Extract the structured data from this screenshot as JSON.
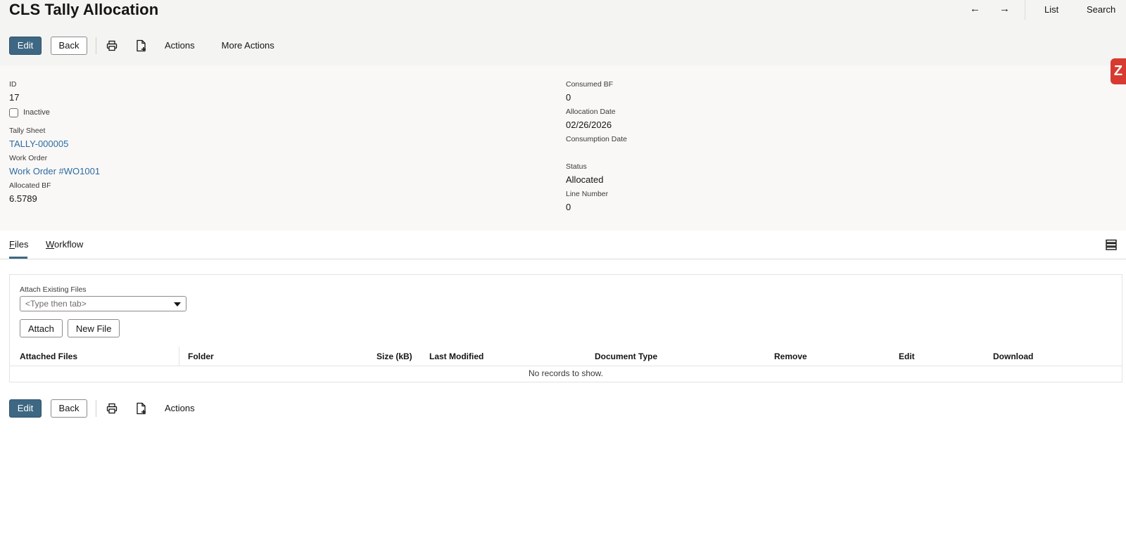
{
  "page": {
    "title": "CLS Tally Allocation"
  },
  "top_nav": {
    "prev_arrow": "←",
    "next_arrow": "→",
    "list_label": "List",
    "search_label": "Search"
  },
  "toolbar_top": {
    "edit_label": "Edit",
    "back_label": "Back",
    "print_icon": "printer-icon",
    "new_doc_icon": "new-document-icon",
    "actions_label": "Actions",
    "more_actions_label": "More Actions"
  },
  "fields": {
    "id_label": "ID",
    "id_value": "17",
    "inactive_label": "Inactive",
    "inactive_checked": false,
    "tally_sheet_label": "Tally Sheet",
    "tally_sheet_value": "TALLY-000005",
    "work_order_label": "Work Order",
    "work_order_value": "Work Order #WO1001",
    "allocated_bf_label": "Allocated BF",
    "allocated_bf_value": "6.5789",
    "consumed_bf_label": "Consumed BF",
    "consumed_bf_value": "0",
    "allocation_date_label": "Allocation Date",
    "allocation_date_value": "02/26/2026",
    "consumption_date_label": "Consumption Date",
    "consumption_date_value": "",
    "status_label": "Status",
    "status_value": "Allocated",
    "line_number_label": "Line Number",
    "line_number_value": "0"
  },
  "zendesk_badge": {
    "glyph": "Z",
    "color": "#d73a2f"
  },
  "tabs": [
    {
      "label_first": "F",
      "label_rest": "iles",
      "active": true
    },
    {
      "label_first": "W",
      "label_rest": "orkflow",
      "active": false
    }
  ],
  "files": {
    "attach_existing_label": "Attach Existing Files",
    "attach_placeholder": "<Type then tab>",
    "attach_button": "Attach",
    "new_file_button": "New File",
    "columns": [
      "Attached Files",
      "Folder",
      "Size (kB)",
      "Last Modified",
      "Document Type",
      "Remove",
      "Edit",
      "Download"
    ],
    "empty_message": "No records to show."
  },
  "toolbar_bottom": {
    "edit_label": "Edit",
    "back_label": "Back",
    "print_icon": "printer-icon",
    "new_doc_icon": "new-document-icon",
    "actions_label": "Actions"
  },
  "colors": {
    "primary_button": "#3e6783",
    "link": "#2d6ba1",
    "header_band": "#f4f4f3",
    "fields_band": "#f9f8f7"
  }
}
